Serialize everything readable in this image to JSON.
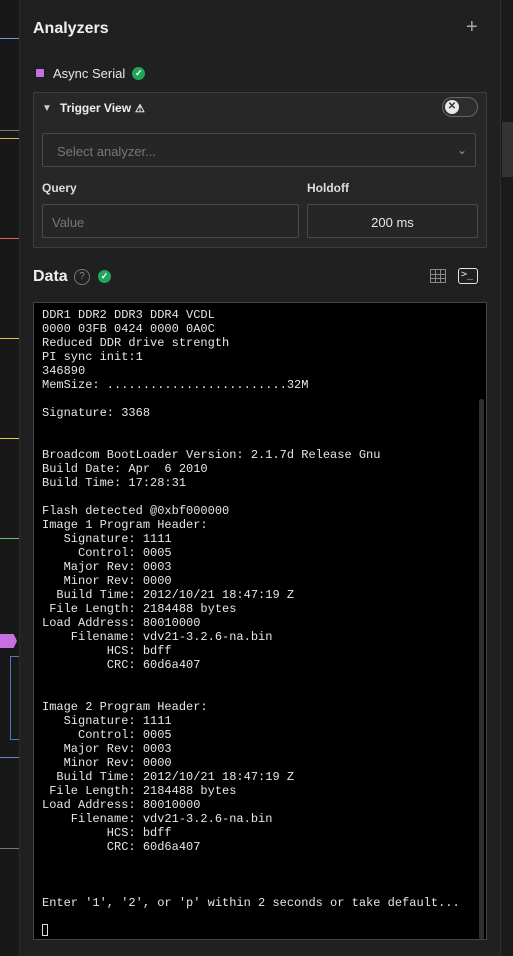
{
  "analyzers": {
    "title": "Analyzers",
    "add_icon": "plus-icon",
    "items": [
      {
        "label": "Async Serial",
        "color": "#c56fe0",
        "status": "ok"
      }
    ]
  },
  "trigger_view": {
    "title": "Trigger View",
    "warning_icon": "⚠",
    "toggle_icon": "✕",
    "select_placeholder": "Select analyzer...",
    "query_label": "Query",
    "query_placeholder": "Value",
    "holdoff_label": "Holdoff",
    "holdoff_value": "200 ms"
  },
  "data_panel": {
    "title": "Data",
    "help_icon": "?",
    "terminal_text": "DDR1 DDR2 DDR3 DDR4 VCDL\n0000 03FB 0424 0000 0A0C\nReduced DDR drive strength\nPI sync init:1\n346890\nMemSize: .........................32M\n\nSignature: 3368\n\n\nBroadcom BootLoader Version: 2.1.7d Release Gnu\nBuild Date: Apr  6 2010\nBuild Time: 17:28:31\n\nFlash detected @0xbf000000\nImage 1 Program Header:\n   Signature: 1111\n     Control: 0005\n   Major Rev: 0003\n   Minor Rev: 0000\n  Build Time: 2012/10/21 18:47:19 Z\n File Length: 2184488 bytes\nLoad Address: 80010000\n    Filename: vdv21-3.2.6-na.bin\n         HCS: bdff\n         CRC: 60d6a407\n\n\nImage 2 Program Header:\n   Signature: 1111\n     Control: 0005\n   Major Rev: 0003\n   Minor Rev: 0000\n  Build Time: 2012/10/21 18:47:19 Z\n File Length: 2184488 bytes\nLoad Address: 80010000\n    Filename: vdv21-3.2.6-na.bin\n         HCS: bdff\n         CRC: 60d6a407\n\n\n\nEnter '1', '2', or 'p' within 2 seconds or take default..."
  },
  "colors": {
    "accent_purple": "#c56fe0",
    "success_green": "#22a55b",
    "background": "#202020"
  }
}
